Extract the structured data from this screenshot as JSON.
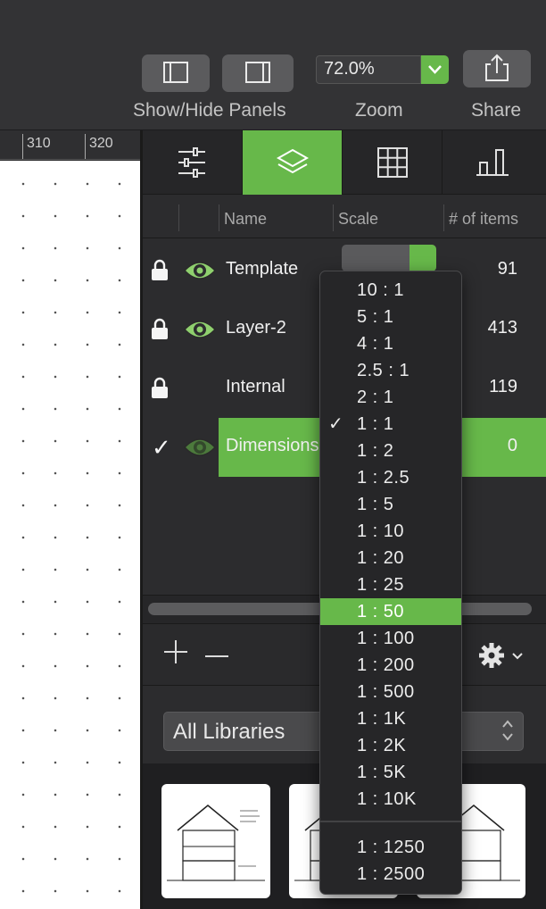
{
  "toolbar": {
    "panels_label": "Show/Hide Panels",
    "zoom_label": "Zoom",
    "zoom_value": "72.0%",
    "share_label": "Share"
  },
  "ruler": {
    "marks": [
      "310",
      "320"
    ]
  },
  "tabs": [
    {
      "name": "inspector",
      "icon": "sliders-icon"
    },
    {
      "name": "layers",
      "icon": "layers-icon",
      "active": true
    },
    {
      "name": "grid",
      "icon": "grid-icon"
    },
    {
      "name": "stats",
      "icon": "bar-chart-icon"
    }
  ],
  "layers_table": {
    "columns": [
      "Name",
      "Scale",
      "# of items"
    ],
    "rows": [
      {
        "name": "Template",
        "count": "91",
        "locked": true,
        "visible": true
      },
      {
        "name": "Layer-2",
        "count": "413",
        "locked": true,
        "visible": true
      },
      {
        "name": "Internal",
        "count": "119",
        "locked": true,
        "visible": false
      },
      {
        "name": "Dimensions",
        "count": "0",
        "locked": false,
        "visible": true,
        "selected": true
      }
    ]
  },
  "scale_menu": {
    "items": [
      "10 : 1",
      "5 : 1",
      "4 : 1",
      "2.5 : 1",
      "2 : 1",
      "1 : 1",
      "1 : 2",
      "1 : 2.5",
      "1 : 5",
      "1 : 10",
      "1 : 20",
      "1 : 25",
      "1 : 50",
      "1 : 100",
      "1 : 200",
      "1 : 500",
      "1 : 1K",
      "1 : 2K",
      "1 : 5K",
      "1 : 10K"
    ],
    "extra_items": [
      "1 : 1250",
      "1 : 2500"
    ],
    "checked": "1 : 1",
    "highlighted": "1 : 50"
  },
  "library": {
    "selected": "All Libraries"
  },
  "colors": {
    "accent": "#67b84a",
    "panel": "#2c2c2e",
    "toolbar": "#333335"
  }
}
